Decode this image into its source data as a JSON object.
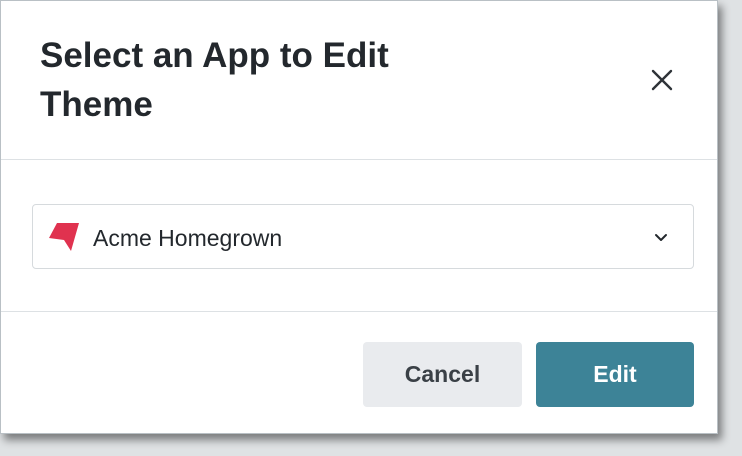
{
  "dialog": {
    "title": "Select an App to Edit Theme",
    "close_icon": "close-icon"
  },
  "app_select": {
    "selected_value": "Acme Homegrown",
    "logo_icon": "app-logo-icon",
    "chevron_icon": "chevron-down-icon"
  },
  "actions": {
    "cancel_label": "Cancel",
    "edit_label": "Edit"
  },
  "colors": {
    "primary": "#3d8397",
    "secondary_button": "#e9ebee",
    "logo": "#e0324f"
  }
}
